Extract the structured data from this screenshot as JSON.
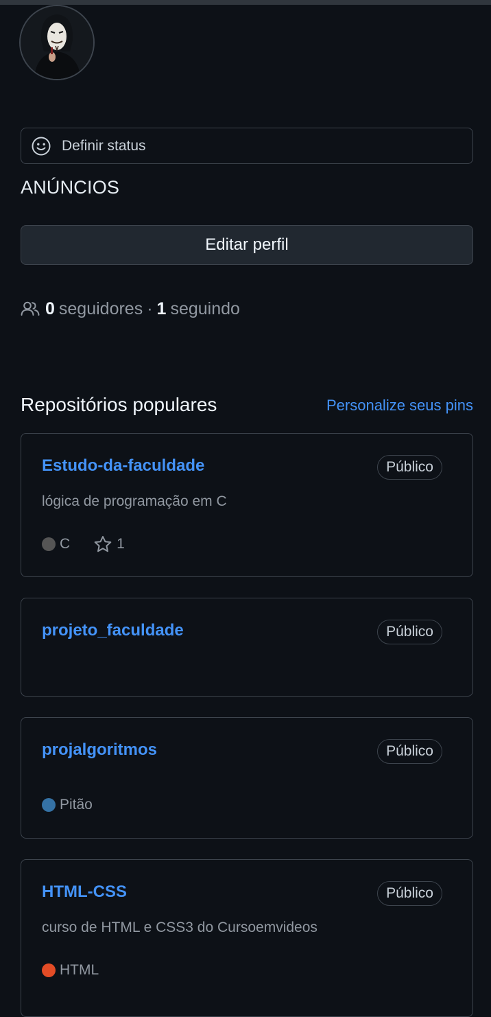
{
  "status": {
    "label": "Definir status",
    "icon": "smiley-icon"
  },
  "announcements": {
    "label": "ANÚNCIOS"
  },
  "profile": {
    "edit_label": "Editar perfil"
  },
  "follow": {
    "followers_count": "0",
    "followers_label": "seguidores",
    "separator": "·",
    "following_count": "1",
    "following_label": "seguindo"
  },
  "popular": {
    "title": "Repositórios populares",
    "customize_link": "Personalize seus pins"
  },
  "repos": [
    {
      "name": "Estudo-da-faculdade",
      "visibility": "Público",
      "description": "lógica de programação em C",
      "language": "C",
      "language_color": "#555555",
      "stars": "1"
    },
    {
      "name": "projeto_faculdade",
      "visibility": "Público"
    },
    {
      "name": "projalgoritmos",
      "visibility": "Público",
      "language": "Pitão",
      "language_color": "#3572A5"
    },
    {
      "name": "HTML-CSS",
      "visibility": "Público",
      "description": "curso de HTML e CSS3 do Cursoemvideos",
      "language": "HTML",
      "language_color": "#e34c26"
    }
  ],
  "colors": {
    "background": "#0d1117",
    "link": "#4493f8",
    "border": "#3d444d",
    "muted": "#9198a1"
  }
}
